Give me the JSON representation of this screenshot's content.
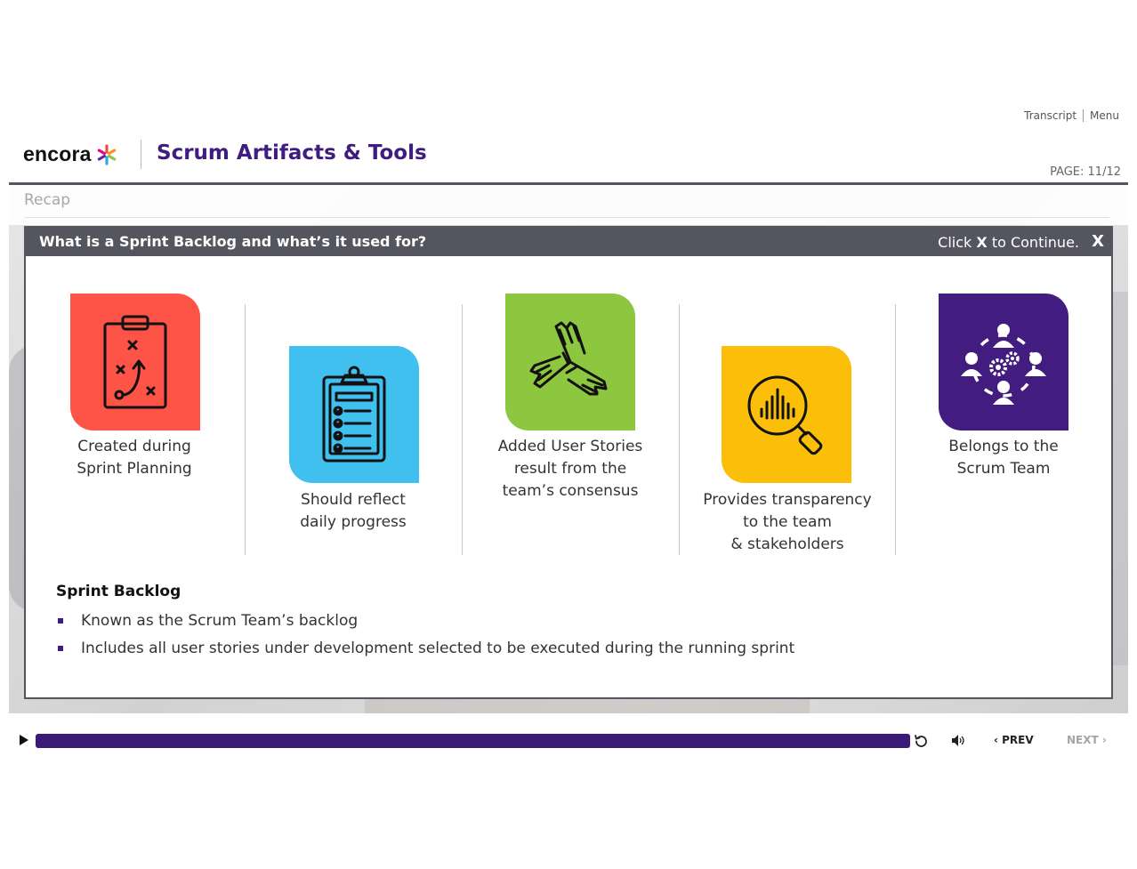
{
  "top_links": {
    "transcript": "Transcript",
    "menu": "Menu"
  },
  "header": {
    "logo_text": "encora",
    "course_title": "Scrum Artifacts & Tools",
    "page_indicator": "PAGE: 11/12"
  },
  "slide": {
    "section_label": "Recap"
  },
  "popup": {
    "title": "What is a Sprint Backlog and what’s it used for?",
    "hint_prefix": "Click",
    "hint_key": "X",
    "hint_suffix": "to Continue.",
    "close_label": "X",
    "columns": [
      {
        "icon": "strategy-clipboard-icon",
        "color": "#fe5448",
        "lines": [
          "Created during",
          "Sprint Planning"
        ]
      },
      {
        "icon": "checklist-clipboard-icon",
        "color": "#40c0ee",
        "lines": [
          "Should reflect",
          "daily progress"
        ]
      },
      {
        "icon": "joined-hands-icon",
        "color": "#8dc63f",
        "lines": [
          "Added User Stories",
          "result from the",
          "team’s consensus"
        ]
      },
      {
        "icon": "magnifier-chart-icon",
        "color": "#fbbf0a",
        "lines": [
          "Provides transparency",
          "to the team",
          "& stakeholders"
        ]
      },
      {
        "icon": "team-gears-icon",
        "color": "#431c7f",
        "lines": [
          "Belongs to the",
          "Scrum Team"
        ]
      }
    ],
    "sprint_backlog": {
      "heading": "Sprint Backlog",
      "bullets": [
        "Known as the Scrum Team’s backlog",
        "Includes all user stories under development selected to be executed during the running sprint"
      ]
    }
  },
  "player": {
    "progress_fraction": 1.0,
    "prev_label": "PREV",
    "next_label": "NEXT",
    "accent_color": "#3d1a78"
  }
}
